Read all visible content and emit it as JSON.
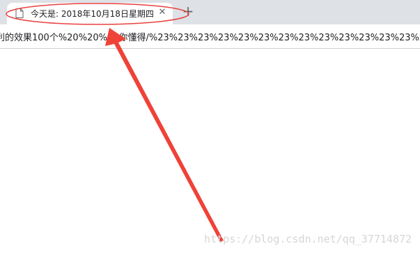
{
  "tab": {
    "title": "今天是: 2018年10月18日星期四",
    "close_glyph": "✕",
    "page_icon": "page-icon"
  },
  "new_tab_glyph": "+",
  "address_bar": {
    "url": "利的效果100个%20%20%20你懂得/%23%23%23%23%23%23%23%23%23%23%23%23%23%23%23%23"
  },
  "annotation": {
    "ellipse_color": "#e8413f",
    "arrow_color": "#ef4238"
  },
  "watermark": {
    "text": "https://blog.csdn.net/qq_37714872"
  }
}
